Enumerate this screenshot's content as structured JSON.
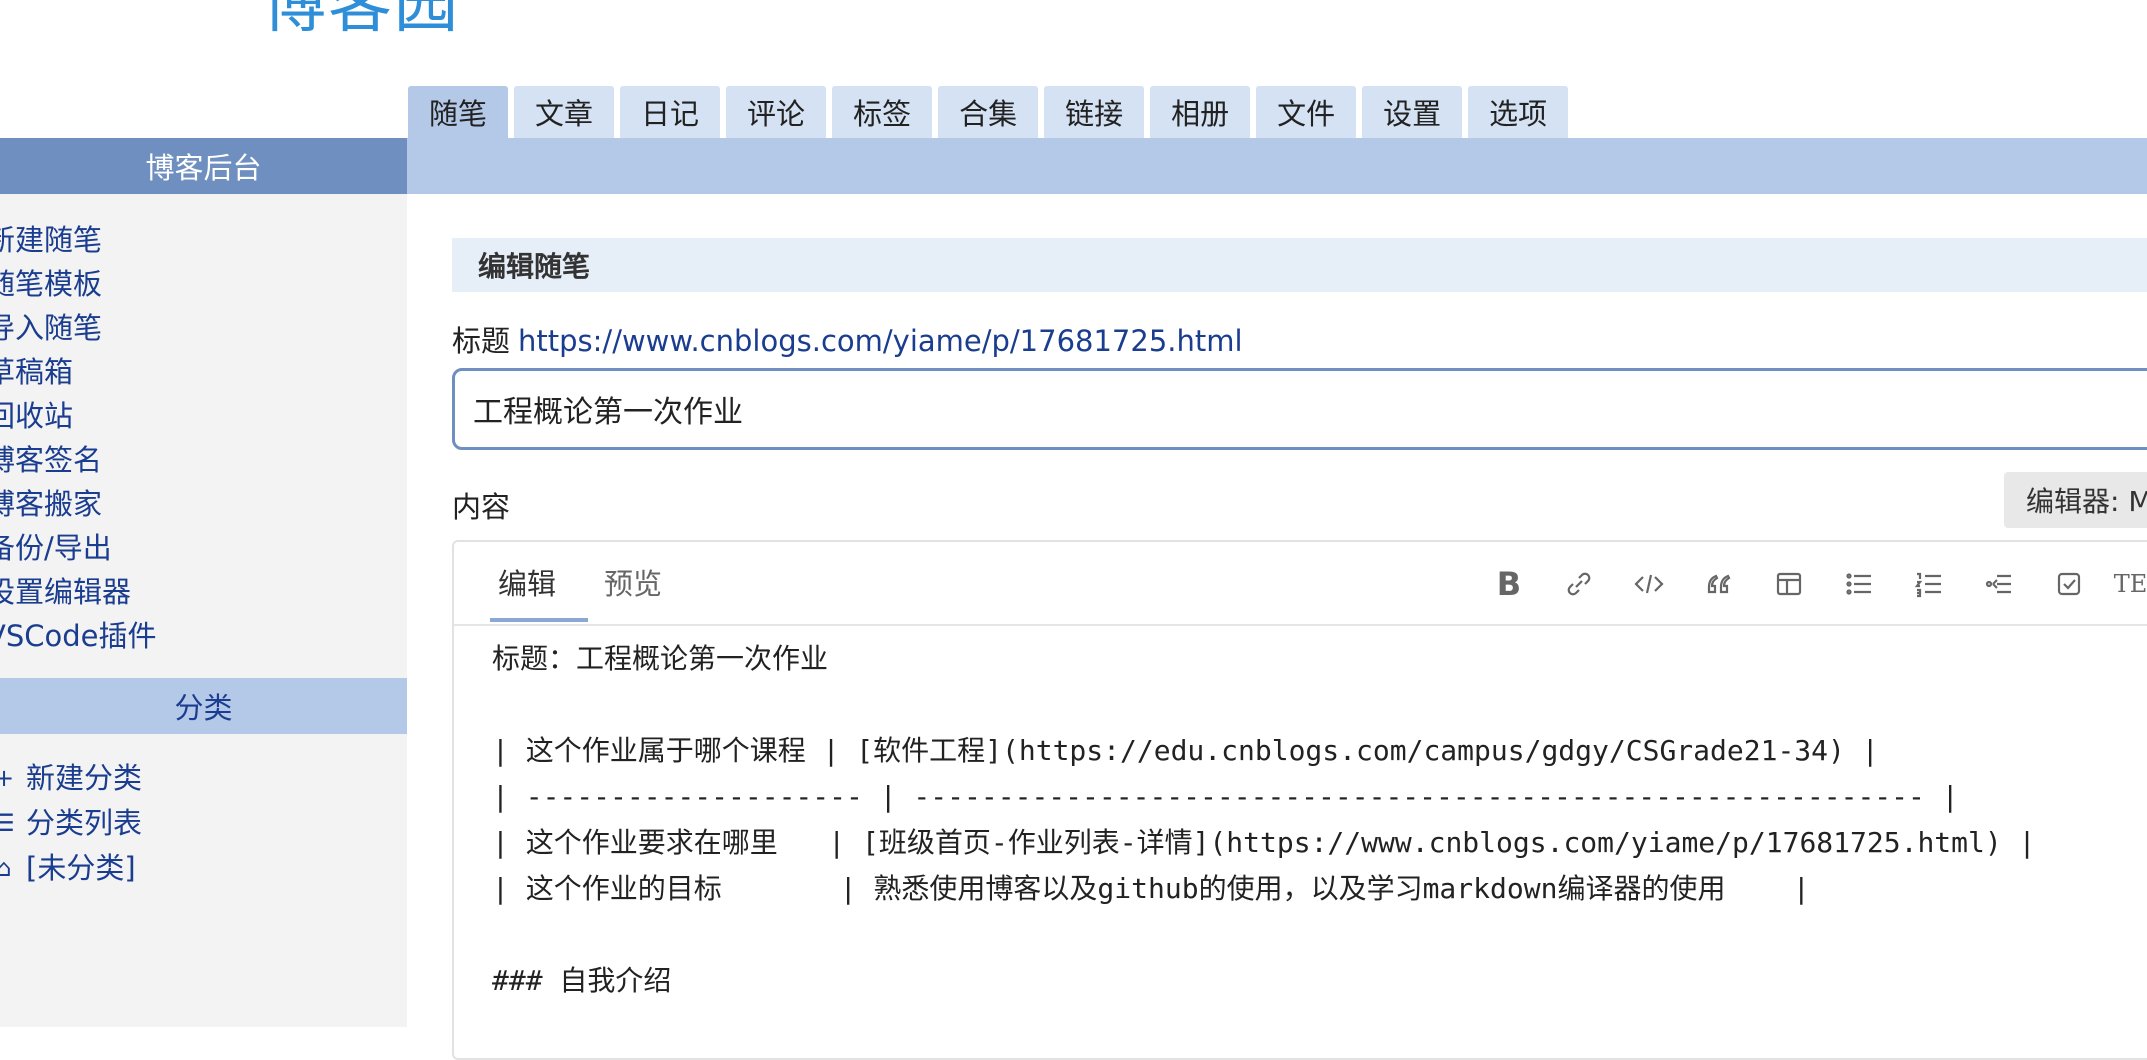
{
  "logo": {
    "text": "博客园"
  },
  "top_tabs": [
    "随笔",
    "文章",
    "日记",
    "评论",
    "标签",
    "合集",
    "链接",
    "相册",
    "文件",
    "设置",
    "选项"
  ],
  "sidebar": {
    "header": "博客后台",
    "items": [
      "新建随笔",
      "随笔模板",
      "导入随笔",
      "草稿箱",
      "回收站",
      "博客签名",
      "博客搬家",
      "备份/导出",
      "设置编辑器",
      "VSCode插件"
    ],
    "category_header": "分类",
    "categories": [
      {
        "icon": "plus-icon",
        "label": "新建分类"
      },
      {
        "icon": "list-icon",
        "label": "分类列表"
      },
      {
        "icon": "tag-icon",
        "label": "[未分类]"
      }
    ]
  },
  "main": {
    "section_title": "编辑随笔",
    "title_label": "标题",
    "title_link": "https://www.cnblogs.com/yiame/p/17681725.html",
    "title_value": "工程概论第一次作业",
    "content_label": "内容",
    "editor_selector": "编辑器: M"
  },
  "editor": {
    "tabs": {
      "edit": "编辑",
      "preview": "预览"
    },
    "toolbar_icons": [
      "bold-icon",
      "link-icon",
      "code-icon",
      "quote-icon",
      "table-icon",
      "unordered-list-icon",
      "ordered-list-icon",
      "outdent-icon",
      "checkbox-icon",
      "tex-icon"
    ],
    "bold_glyph": "B",
    "tex_glyph": "TEX",
    "content": "标题：工程概论第一次作业\n\n| 这个作业属于哪个课程 | [软件工程](https://edu.cnblogs.com/campus/gdgy/CSGrade21-34) |\n| -------------------- | ------------------------------------------------------------ |\n| 这个作业要求在哪里   | [班级首页-作业列表-详情](https://www.cnblogs.com/yiame/p/17681725.html) |\n| 这个作业的目标       | 熟悉使用博客以及github的使用，以及学习markdown编译器的使用    |\n\n### 自我介绍"
  }
}
